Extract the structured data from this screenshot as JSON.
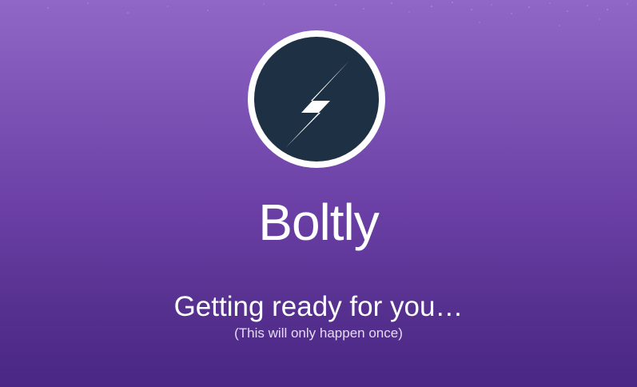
{
  "app": {
    "name": "Boltly",
    "logo_icon": "lightning-bolt-icon"
  },
  "loading": {
    "status": "Getting ready for you…",
    "note": "(This will only happen once)"
  },
  "colors": {
    "background_top": "#9066c6",
    "background_bottom": "#4a2784",
    "logo_fill": "#1d3044",
    "logo_ring": "#ffffff",
    "text": "#ffffff"
  }
}
